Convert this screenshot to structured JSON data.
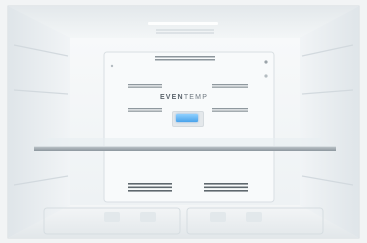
{
  "panel": {
    "brand_part1": "EVEN",
    "brand_part2": "TEMP"
  },
  "colors": {
    "interior": "#eef2f4",
    "shelf_edge": "#a7b0b6",
    "display": "#4aa3ea"
  }
}
